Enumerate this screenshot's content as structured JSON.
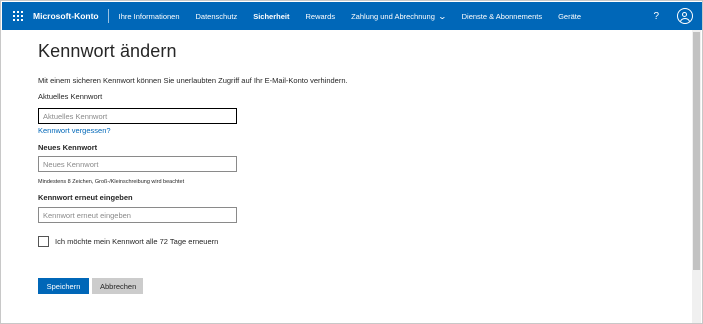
{
  "header": {
    "brand": "Microsoft-Konto",
    "nav": [
      {
        "label": "Ihre Informationen",
        "active": false
      },
      {
        "label": "Datenschutz",
        "active": false
      },
      {
        "label": "Sicherheit",
        "active": true
      },
      {
        "label": "Rewards",
        "active": false
      },
      {
        "label": "Zahlung und Abrechnung",
        "active": false,
        "dropdown": true
      },
      {
        "label": "Dienste & Abonnements",
        "active": false
      },
      {
        "label": "Geräte",
        "active": false
      }
    ],
    "help_label": "?",
    "icons": {
      "waffle": "app-launcher-icon",
      "avatar": "user-avatar-icon",
      "dropdown": "chevron-down-icon"
    },
    "colors": {
      "bar": "#0067b8",
      "text": "#ffffff"
    }
  },
  "main": {
    "title": "Kennwort ändern",
    "intro": "Mit einem sicheren Kennwort können Sie unerlaubten Zugriff auf Ihr E-Mail-Konto verhindern.",
    "current_password": {
      "label": "Aktuelles Kennwort",
      "placeholder": "Aktuelles Kennwort",
      "value": ""
    },
    "forgot_link": "Kennwort vergessen?",
    "new_password": {
      "label": "Neues Kennwort",
      "placeholder": "Neues Kennwort",
      "value": "",
      "hint": "Mindestens 8 Zeichen, Groß-/Kleinschreibung wird beachtet"
    },
    "confirm_password": {
      "label": "Kennwort erneut eingeben",
      "placeholder": "Kennwort erneut eingeben",
      "value": ""
    },
    "renew_checkbox": {
      "label": "Ich möchte mein Kennwort alle 72 Tage erneuern",
      "checked": false
    },
    "save_label": "Speichern",
    "cancel_label": "Abbrechen",
    "colors": {
      "accent": "#0067b8",
      "secondary_button": "#cccccc"
    }
  }
}
